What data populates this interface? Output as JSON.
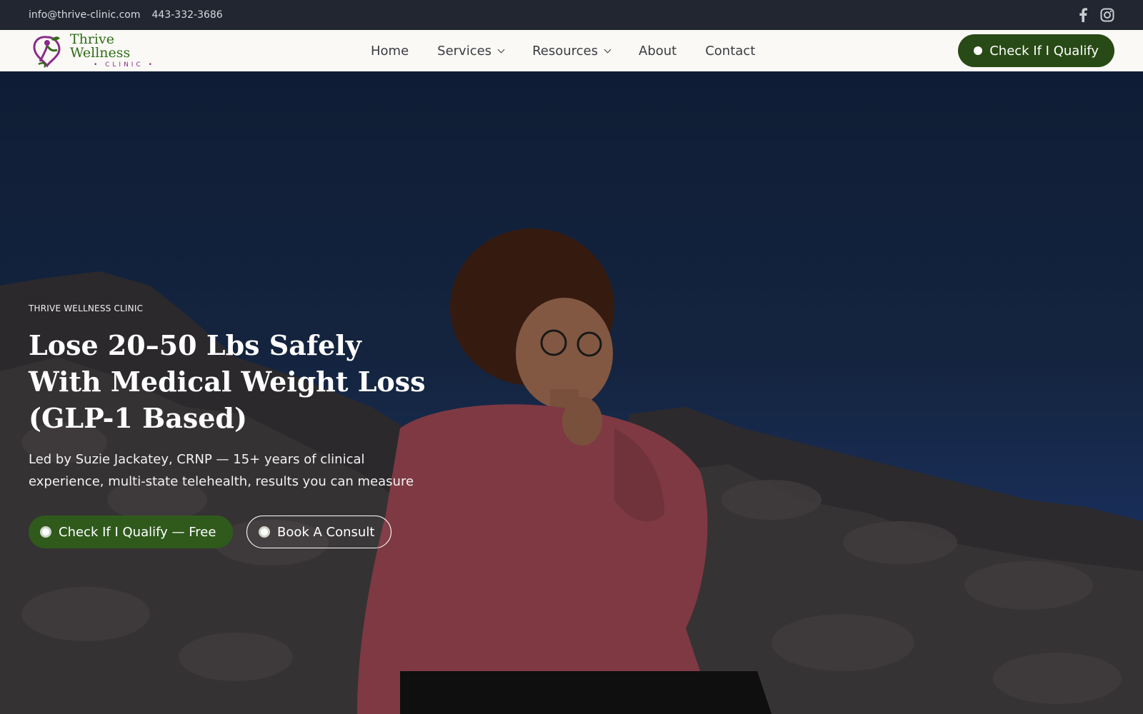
{
  "topbar": {
    "email": "info@thrive-clinic.com",
    "phone": "443-332-3686",
    "social_icons": [
      "facebook-icon",
      "instagram-icon"
    ]
  },
  "nav": {
    "logo_name": "Thrive Wellness",
    "logo_sub": "• CLINIC •",
    "items": [
      {
        "label": "Home",
        "dropdown": false
      },
      {
        "label": "Services",
        "dropdown": true
      },
      {
        "label": "Resources",
        "dropdown": true
      },
      {
        "label": "About",
        "dropdown": false
      },
      {
        "label": "Contact",
        "dropdown": false
      }
    ],
    "cta_label": "Check If I Qualify"
  },
  "hero": {
    "eyebrow": "THRIVE WELLNESS CLINIC",
    "headline": "Lose 20–50 Lbs Safely With Medical Weight Loss (GLP-1 Based)",
    "subtext": "Led by Suzie Jackatey, CRNP — 15+ years of clinical experience, multi-state telehealth, results you can measure",
    "primary_button": "Check If I Qualify — Free",
    "secondary_button": "Book A Consult"
  },
  "colors": {
    "topbar_bg": "#222630",
    "nav_bg": "#faf9f5",
    "brand_green": "#284a16",
    "logo_purple": "#8a2a8a"
  }
}
